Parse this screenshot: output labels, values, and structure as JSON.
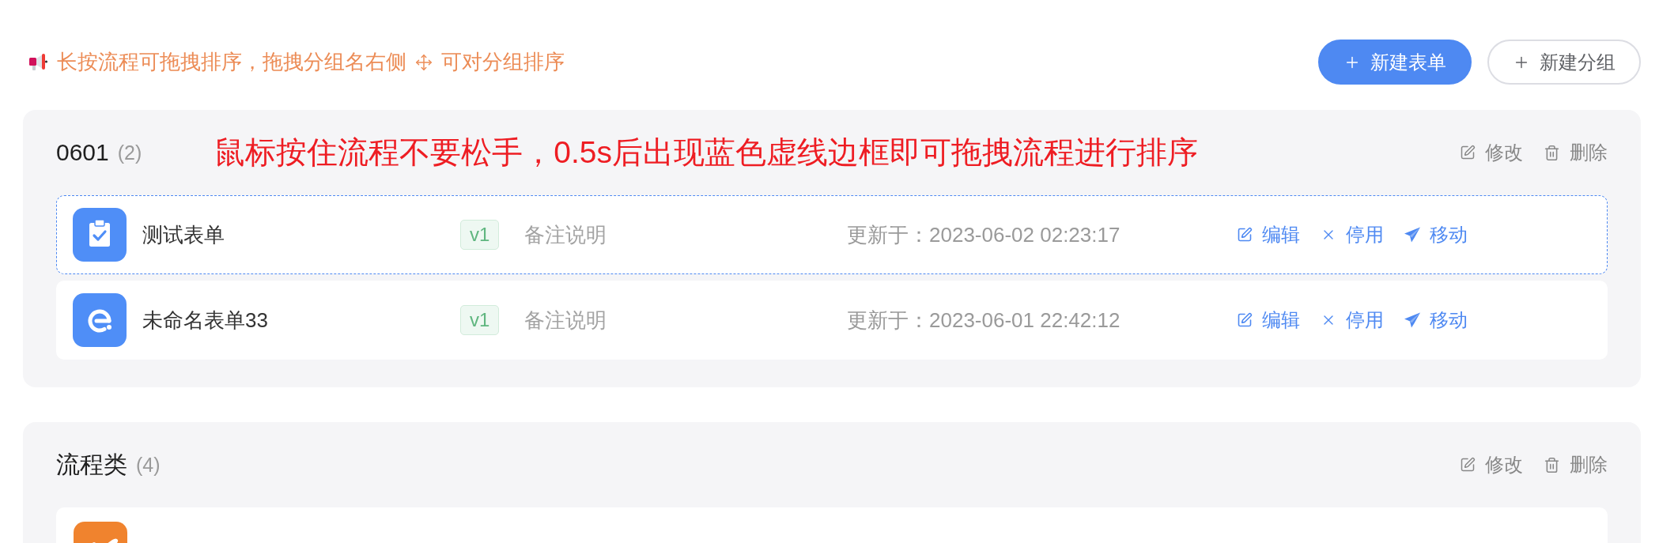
{
  "notice": {
    "parts": [
      "长按流程可拖拽排序，拖拽分组名右侧",
      "可对分组排序"
    ]
  },
  "buttons": [
    {
      "label": "新建表单",
      "kind": "primary"
    },
    {
      "label": "新建分组",
      "kind": "default"
    }
  ],
  "groups": [
    {
      "title": "0601",
      "count": "(2)",
      "tip": "鼠标按住流程不要松手，0.5s后出现蓝色虚线边框即可拖拽流程进行排序",
      "actions": [
        {
          "kind": "edit",
          "label": "修改"
        },
        {
          "kind": "delete",
          "label": "删除"
        }
      ],
      "forms": [
        {
          "kind": "clipboard",
          "color": "#4f8ef7",
          "name": "测试表单",
          "version": "v1",
          "remark": "备注说明",
          "updated": "更新于：2023-06-02 02:23:17",
          "dragging": true,
          "actions": [
            {
              "kind": "edit",
              "label": "编辑"
            },
            {
              "kind": "disable",
              "label": "停用"
            },
            {
              "kind": "move",
              "label": "移动"
            }
          ]
        },
        {
          "kind": "ring",
          "color": "#4f8ef7",
          "name": "未命名表单33",
          "version": "v1",
          "remark": "备注说明",
          "updated": "更新于：2023-06-01 22:42:12",
          "dragging": false,
          "actions": [
            {
              "kind": "edit",
              "label": "编辑"
            },
            {
              "kind": "disable",
              "label": "停用"
            },
            {
              "kind": "move",
              "label": "移动"
            }
          ]
        }
      ]
    },
    {
      "title": "流程类",
      "count": "(4)",
      "actions": [
        {
          "kind": "edit",
          "label": "修改"
        },
        {
          "kind": "delete",
          "label": "删除"
        }
      ],
      "forms": [
        {
          "kind": "plane",
          "color": "#f0832e"
        }
      ]
    }
  ]
}
